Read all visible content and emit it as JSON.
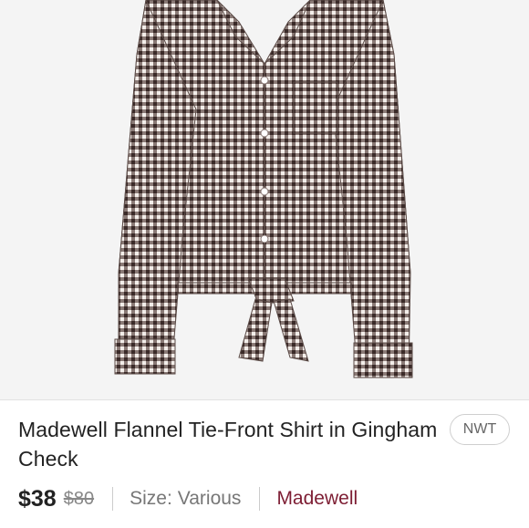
{
  "listing": {
    "title": "Madewell Flannel Tie-Front Shirt in Gingham Check",
    "condition_badge": "NWT",
    "price": "$38",
    "original_price": "$80",
    "size_label": "Size:",
    "size_value": "Various",
    "brand": "Madewell"
  },
  "colors": {
    "gingham_dark": "#3a2a28",
    "gingham_light": "#f3eeea",
    "brand": "#7d1d33"
  },
  "image": {
    "subject": "checked tie-front shirt"
  }
}
